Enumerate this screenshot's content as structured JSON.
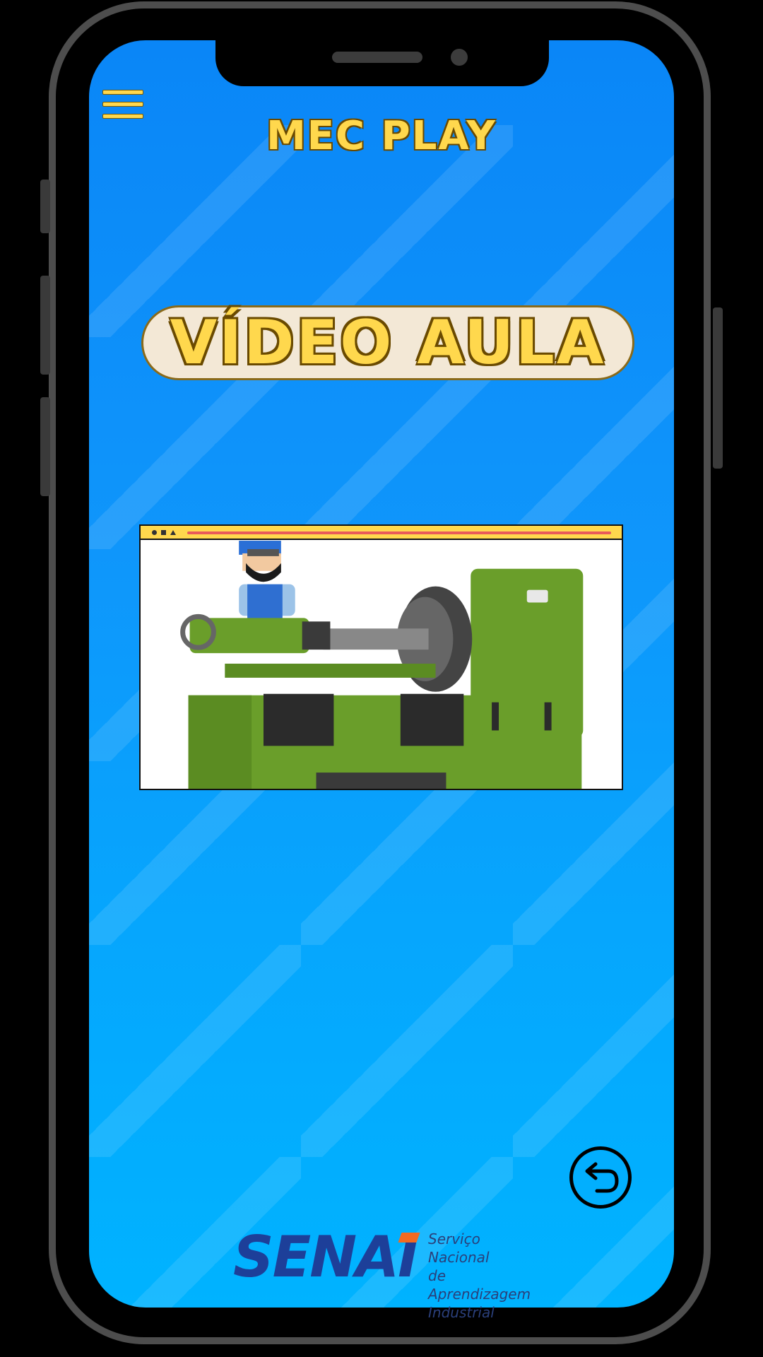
{
  "app": {
    "title": "MEC PLAY"
  },
  "banner": {
    "text": "VÍDEO AULA"
  },
  "footer": {
    "logo": "SENAI",
    "subtitle_lines": [
      "Serviço Nacional",
      "de Aprendizagem",
      "Industrial"
    ]
  },
  "icons": {
    "menu": "hamburger-menu-icon",
    "back": "undo-arrow-icon"
  },
  "colors": {
    "accent_yellow": "#ffd84d",
    "background_top": "#0a86f7",
    "background_bottom": "#00b3ff",
    "brand_blue": "#1d3f99",
    "brand_orange": "#f26a21"
  }
}
